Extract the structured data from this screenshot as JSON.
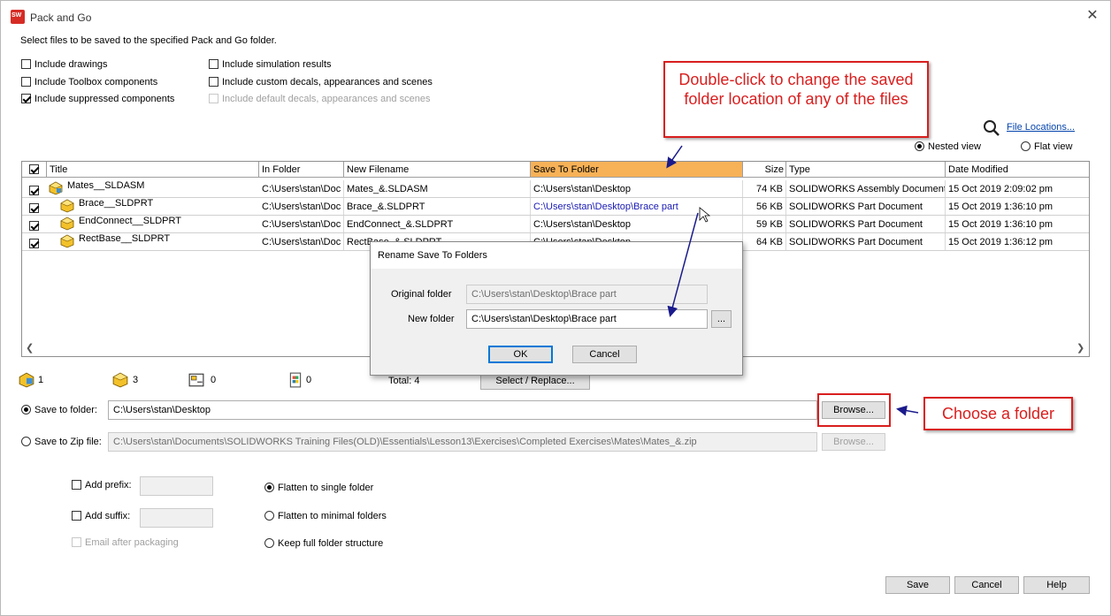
{
  "window": {
    "title": "Pack and Go",
    "close_label": "✕"
  },
  "instruction": "Select files to be saved to the specified Pack and Go folder.",
  "options": {
    "include_drawings": "Include drawings",
    "include_toolbox": "Include Toolbox components",
    "include_suppressed": "Include suppressed components",
    "include_simulation": "Include simulation results",
    "include_custom_decals": "Include custom decals, appearances and scenes",
    "include_default_decals": "Include default decals, appearances and scenes"
  },
  "file_locations_link": "File Locations...",
  "views": {
    "nested": "Nested view",
    "flat": "Flat view"
  },
  "table": {
    "columns": [
      "Title",
      "In Folder",
      "New Filename",
      "Save To Folder",
      "Size",
      "Type",
      "Date Modified"
    ],
    "rows": [
      {
        "title": "Mates__SLDASM",
        "in_folder": "C:\\Users\\stan\\Doc",
        "new_filename": "Mates_&.SLDASM",
        "save_to": "C:\\Users\\stan\\Desktop",
        "size": "74 KB",
        "type": "SOLIDWORKS Assembly Document",
        "date": "15 Oct 2019 2:09:02 pm"
      },
      {
        "title": "Brace__SLDPRT",
        "in_folder": "C:\\Users\\stan\\Doc",
        "new_filename": "Brace_&.SLDPRT",
        "save_to": "C:\\Users\\stan\\Desktop\\Brace part",
        "size": "56 KB",
        "type": "SOLIDWORKS Part Document",
        "date": "15 Oct 2019 1:36:10 pm"
      },
      {
        "title": "EndConnect__SLDPRT",
        "in_folder": "C:\\Users\\stan\\Doc",
        "new_filename": "EndConnect_&.SLDPRT",
        "save_to": "C:\\Users\\stan\\Desktop",
        "size": "59 KB",
        "type": "SOLIDWORKS Part Document",
        "date": "15 Oct 2019 1:36:10 pm"
      },
      {
        "title": "RectBase__SLDPRT",
        "in_folder": "C:\\Users\\stan\\Doc",
        "new_filename": "RectBase_&.SLDPRT",
        "save_to": "C:\\Users\\stan\\Desktop",
        "size": "64 KB",
        "type": "SOLIDWORKS Part Document",
        "date": "15 Oct 2019 1:36:12 pm"
      }
    ]
  },
  "counts": {
    "assemblies": "1",
    "parts": "3",
    "drawings": "0",
    "other": "0",
    "total": "Total: 4"
  },
  "select_replace": "Select / Replace...",
  "save_to_folder": {
    "label": "Save to folder:",
    "value": "C:\\Users\\stan\\Desktop",
    "browse": "Browse..."
  },
  "save_to_zip": {
    "label": "Save to Zip file:",
    "value": "C:\\Users\\stan\\Documents\\SOLIDWORKS Training Files(OLD)\\Essentials\\Lesson13\\Exercises\\Completed Exercises\\Mates\\Mates_&.zip",
    "browse": "Browse..."
  },
  "prefix": {
    "label": "Add prefix:",
    "value": ""
  },
  "suffix": {
    "label": "Add suffix:",
    "value": ""
  },
  "email": "Email after packaging",
  "structure": {
    "flatten_single": "Flatten to single folder",
    "flatten_minimal": "Flatten to minimal folders",
    "keep_full": "Keep full folder structure"
  },
  "buttons": {
    "save": "Save",
    "cancel": "Cancel",
    "help": "Help"
  },
  "dialog": {
    "title": "Rename Save To Folders",
    "original_label": "Original folder",
    "original_value": "C:\\Users\\stan\\Desktop\\Brace part",
    "new_label": "New folder",
    "new_value": "C:\\Users\\stan\\Desktop\\Brace part",
    "dots": "...",
    "ok": "OK",
    "cancel": "Cancel"
  },
  "callouts": {
    "double_click": "Double-click to change the saved folder location of any of the files",
    "choose_folder": "Choose a folder"
  },
  "colors": {
    "accent_header": "#f7b157",
    "callout_red": "#d91e1e",
    "link_blue": "#0645ad",
    "arrow_navy": "#1a1a8c"
  }
}
